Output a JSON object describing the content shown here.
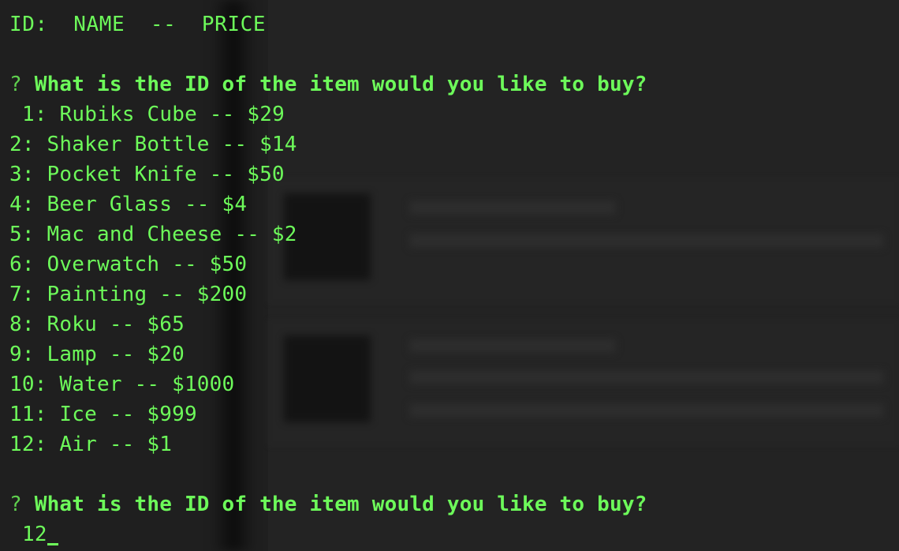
{
  "header": {
    "id": "ID:",
    "name": "NAME",
    "sep": "--",
    "price": "PRICE"
  },
  "prompt1": {
    "mark": "?",
    "question": "What is the ID of the item would you like to buy?"
  },
  "items": [
    {
      "line": "1: Rubiks Cube -- $29"
    },
    {
      "line": "2: Shaker Bottle -- $14"
    },
    {
      "line": "3: Pocket Knife -- $50"
    },
    {
      "line": "4: Beer Glass -- $4"
    },
    {
      "line": "5: Mac and Cheese -- $2"
    },
    {
      "line": "6: Overwatch -- $50"
    },
    {
      "line": "7: Painting -- $200"
    },
    {
      "line": "8: Roku -- $65"
    },
    {
      "line": "9: Lamp -- $20"
    },
    {
      "line": "10: Water -- $1000"
    },
    {
      "line": "11: Ice -- $999"
    },
    {
      "line": "12: Air -- $1"
    }
  ],
  "prompt2": {
    "mark": "?",
    "question": "What is the ID of the item would you like to buy?"
  },
  "input": {
    "value": "12"
  },
  "colors": {
    "text": "#6dfa5a",
    "background": "#1f1f1f"
  }
}
